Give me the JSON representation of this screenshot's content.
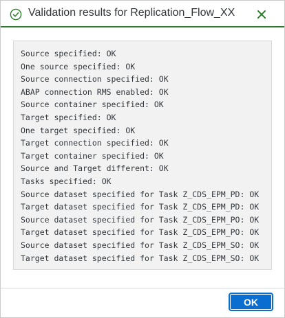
{
  "dialog": {
    "title": "Validation results for Replication_Flow_XX",
    "status_icon": "check-circle-icon",
    "close_icon": "close-icon",
    "colors": {
      "success": "#2b7d2b",
      "header_border": "#2b7d2b",
      "button_bg": "#0a6ed1",
      "content_bg": "#f2f2f2"
    }
  },
  "results": {
    "lines": [
      "Source specified: OK",
      "One source specified: OK",
      "Source connection specified: OK",
      "ABAP connection RMS enabled: OK",
      "Source container specified: OK",
      "Target specified: OK",
      "One target specified: OK",
      "Target connection specified: OK",
      "Target container specified: OK",
      "Source and Target different: OK",
      "Tasks specified: OK",
      "Source dataset specified for Task Z_CDS_EPM_PD: OK",
      "Target dataset specified for Task Z_CDS_EPM_PD: OK",
      "Source dataset specified for Task Z_CDS_EPM_PO: OK",
      "Target dataset specified for Task Z_CDS_EPM_PO: OK",
      "Source dataset specified for Task Z_CDS_EPM_SO: OK",
      "Target dataset specified for Task Z_CDS_EPM_SO: OK"
    ]
  },
  "footer": {
    "ok_label": "OK"
  }
}
